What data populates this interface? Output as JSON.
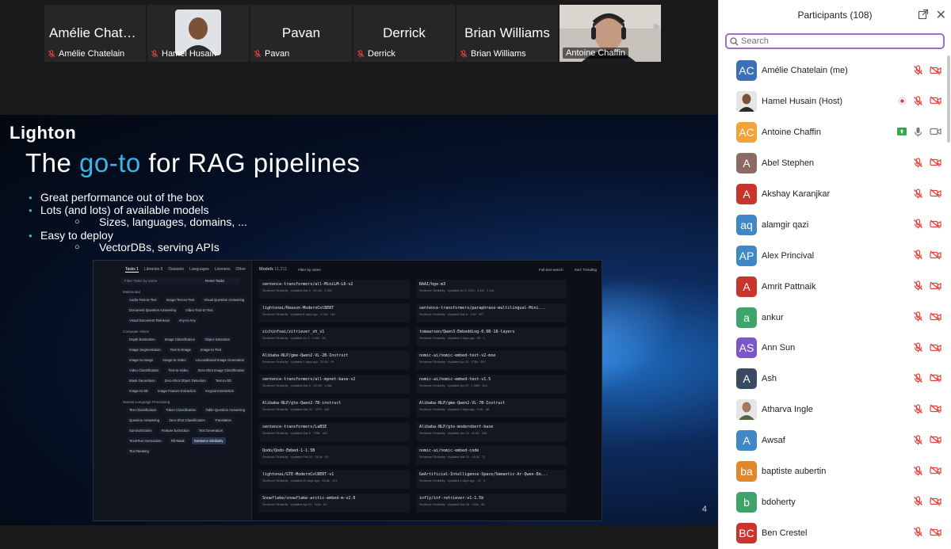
{
  "strip": {
    "tiles": [
      {
        "big": "Amélie Chate...",
        "label": "Amélie Chatelain",
        "photo": false
      },
      {
        "big": "",
        "label": "Hamel Husain",
        "photo": true
      },
      {
        "big": "Pavan",
        "label": "Pavan",
        "photo": false
      },
      {
        "big": "Derrick",
        "label": "Derrick",
        "photo": false
      },
      {
        "big": "Brian Williams",
        "label": "Brian Williams",
        "photo": false
      },
      {
        "big": "",
        "label": "Antoine Chaffin",
        "photo": true,
        "active": true
      }
    ]
  },
  "slide": {
    "logo": "Lighton",
    "title_pre": "The ",
    "title_hl": "go-to",
    "title_post": " for RAG pipelines",
    "bullets": [
      {
        "level": 1,
        "text": "Great performance out of the box"
      },
      {
        "level": 1,
        "text": "Lots (and lots) of available models"
      },
      {
        "level": 2,
        "text": "Sizes, languages, domains, ..."
      },
      {
        "level": 1,
        "text": "Easy to deploy"
      },
      {
        "level": 2,
        "text": "VectorDBs, serving APIs"
      }
    ],
    "page_number": "4",
    "hf": {
      "tabs": [
        "Tasks 1",
        "Libraries 8",
        "Datasets",
        "Languages",
        "Licenses",
        "Other"
      ],
      "filter_placeholder": "Filter Tasks by name",
      "reset": "Reset Tasks",
      "sections": [
        {
          "title": "Multimodal",
          "chips": [
            "Audio-Text-to-Text",
            "Image-Text-to-Text",
            "Visual Question Answering",
            "Document Question Answering",
            "Video-Text-to-Text",
            "Visual Document Retrieval",
            "Any-to-Any"
          ]
        },
        {
          "title": "Computer Vision",
          "chips": [
            "Depth Estimation",
            "Image Classification",
            "Object Detection",
            "Image Segmentation",
            "Text-to-Image",
            "Image-to-Text",
            "Image-to-Image",
            "Image-to-Video",
            "Unconditional Image Generation",
            "Video Classification",
            "Text-to-Video",
            "Zero-Shot Image Classification",
            "Mask Generation",
            "Zero-Shot Object Detection",
            "Text-to-3D",
            "Image-to-3D",
            "Image Feature Extraction",
            "Keypoint Detection"
          ]
        },
        {
          "title": "Natural Language Processing",
          "chips": [
            "Text Classification",
            "Token Classification",
            "Table Question Answering",
            "Question Answering",
            "Zero-Shot Classification",
            "Translation",
            "Summarization",
            "Feature Extraction",
            "Text Generation",
            "Text2Text Generation",
            "Fill-Mask",
            "Sentence Similarity",
            "Text Ranking"
          ]
        }
      ],
      "models_label": "Models",
      "models_count": "11,211",
      "filter_name": "Filter by name",
      "fulltext": "Full-text search",
      "sort": "Sort: Trending",
      "cards": [
        {
          "name": "sentence-transformers/all-MiniLM-L6-v2",
          "meta": "Sentence Similarity · Updated Mar 6 · 90.4M · 3.52k"
        },
        {
          "name": "BAAI/bge-m3",
          "meta": "Sentence Similarity · Updated Jul 3, 2024 · 3.4M · 2.12k"
        },
        {
          "name": "lightonai/Reason-ModernColBERT",
          "meta": "Sentence Similarity · Updated 8 days ago · 2.94k · 181"
        },
        {
          "name": "sentence-transformers/paraphrase-multilingual-Mini...",
          "meta": "Sentence Similarity · Updated Mar 6 · 12M · 907"
        },
        {
          "name": "zichinfoai/zitriever_zh_v1",
          "meta": "Sentence Similarity · Updated Jul 3 · 3.56k · 26"
        },
        {
          "name": "tomaarsen/Qwen3-Embedding-0.6B-18-layers",
          "meta": "Sentence Similarity · Updated 5 days ago · 85 · 1"
        },
        {
          "name": "Alibaba-NLP/gme-Qwen2-VL-2B-Instruct",
          "meta": "Sentence Similarity · Updated 2 days ago · 32.5k · 79"
        },
        {
          "name": "nomic-ai/nomic-embed-text-v2-moe",
          "meta": "Sentence Similarity · Updated Apr 19 · 176k · 397"
        },
        {
          "name": "sentence-transformers/all-mpnet-base-v2",
          "meta": "Sentence Similarity · Updated Mar 6 · 20.3M · 1.06k"
        },
        {
          "name": "nomic-ai/nomic-embed-text-v1.5",
          "meta": "Sentence Similarity · Updated Apr 29 · 1.58M · 644"
        },
        {
          "name": "Alibaba-NLP/gte-Qwen2-7B-instruct",
          "meta": "Sentence Similarity · Updated Mar 24 · 237k · 453"
        },
        {
          "name": "Alibaba-NLP/gme-Qwen2-VL-7B-Instruct",
          "meta": "Sentence Similarity · Updated 2 days ago · 5.5k · 48"
        },
        {
          "name": "sentence-transformers/LaBSE",
          "meta": "Sentence Similarity · Updated Mar 6 · 798k · 282"
        },
        {
          "name": "Alibaba-NLP/gte-modernbert-base",
          "meta": "Sentence Similarity · Updated Jan 24 · 42.6k · 166"
        },
        {
          "name": "Qodo/Qodo-Embed-1-1.5B",
          "meta": "Sentence Similarity · Updated Feb 24 · 16.3k · 53"
        },
        {
          "name": "nomic-ai/nomic-embed-code",
          "meta": "Sentence Similarity · Updated Mar 31 · 18.6k · 72"
        },
        {
          "name": "lightonai/GTE-ModernColBERT-v1",
          "meta": "Sentence Similarity · Updated 25 days ago · 53.8k · 123"
        },
        {
          "name": "GeArtificial-Intelligence-Space/Semantic-Ar-Qwen-Em...",
          "meta": "Sentence Similarity · Updated 4 days ago · 13 · 3"
        },
        {
          "name": "Snowflake/snowflake-arctic-embed-m-v2.0",
          "meta": "Sentence Similarity · Updated Apr 24 · 164k · 80"
        },
        {
          "name": "infly/inf-retriever-v1-1.5b",
          "meta": "Sentence Similarity · Updated Mar 28 · 164k · 38"
        }
      ]
    }
  },
  "panel": {
    "title": "Participants (108)",
    "search_placeholder": "Search",
    "participants": [
      {
        "initials": "AC",
        "name": "Amélie Chatelain (me)",
        "color": "#3b6fb6",
        "photo": false,
        "extra": "",
        "mic": "muted",
        "video": "off"
      },
      {
        "initials": "",
        "name": "Hamel Husain (Host)",
        "color": "#444444",
        "photo": true,
        "extra": "record",
        "mic": "muted",
        "video": "off"
      },
      {
        "initials": "AC",
        "name": "Antoine Chaffin",
        "color": "#f2a33a",
        "photo": false,
        "extra": "share",
        "mic": "on",
        "video": "on"
      },
      {
        "initials": "A",
        "name": "Abel Stephen",
        "color": "#8b6b63",
        "photo": false,
        "extra": "",
        "mic": "muted",
        "video": "off"
      },
      {
        "initials": "A",
        "name": "Akshay Karanjkar",
        "color": "#c8352d",
        "photo": false,
        "extra": "",
        "mic": "muted",
        "video": "off"
      },
      {
        "initials": "aq",
        "name": "alamgir qazi",
        "color": "#3f88c5",
        "photo": false,
        "extra": "",
        "mic": "muted",
        "video": "off"
      },
      {
        "initials": "AP",
        "name": "Alex Princival",
        "color": "#3f88c5",
        "photo": false,
        "extra": "",
        "mic": "muted",
        "video": "off"
      },
      {
        "initials": "A",
        "name": "Amrit Pattnaik",
        "color": "#c8352d",
        "photo": false,
        "extra": "",
        "mic": "muted",
        "video": "off"
      },
      {
        "initials": "a",
        "name": "ankur",
        "color": "#3ea46a",
        "photo": false,
        "extra": "",
        "mic": "muted",
        "video": "off"
      },
      {
        "initials": "AS",
        "name": "Ann Sun",
        "color": "#7b57c9",
        "photo": false,
        "extra": "",
        "mic": "muted",
        "video": "off"
      },
      {
        "initials": "A",
        "name": "Ash",
        "color": "#3a4a63",
        "photo": false,
        "extra": "",
        "mic": "muted",
        "video": "off"
      },
      {
        "initials": "",
        "name": "Atharva Ingle",
        "color": "#6a7a5a",
        "photo": true,
        "extra": "",
        "mic": "muted",
        "video": "off"
      },
      {
        "initials": "A",
        "name": "Awsaf",
        "color": "#3f88c5",
        "photo": false,
        "extra": "",
        "mic": "muted",
        "video": "off"
      },
      {
        "initials": "ba",
        "name": "baptiste aubertin",
        "color": "#e0872b",
        "photo": false,
        "extra": "",
        "mic": "muted",
        "video": "off"
      },
      {
        "initials": "b",
        "name": "bdoherty",
        "color": "#3ea46a",
        "photo": false,
        "extra": "",
        "mic": "muted",
        "video": "off"
      },
      {
        "initials": "BC",
        "name": "Ben Crestel",
        "color": "#c8352d",
        "photo": false,
        "extra": "",
        "mic": "muted",
        "video": "off"
      }
    ]
  },
  "colors": {
    "accent": "#3fb3e8",
    "muted_red": "#e0413a",
    "active_green": "#3fbf5a",
    "search_border": "#9b6fd1"
  }
}
